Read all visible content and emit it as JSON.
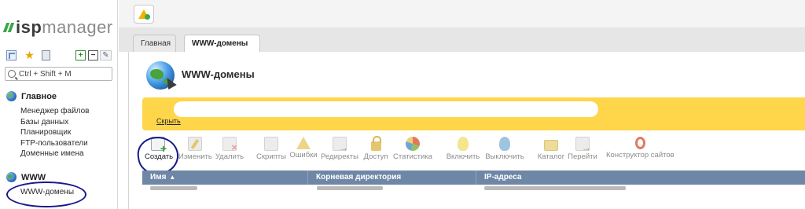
{
  "logo": {
    "isp": "isp",
    "manager": "manager"
  },
  "sidebar": {
    "search": {
      "placeholder": "Ctrl + Shift + M"
    },
    "toolbar_icons": [
      "tree-view-icon",
      "star-icon",
      "clipboard-icon",
      "expand-all-icon",
      "collapse-all-icon",
      "pin-icon"
    ],
    "sections": [
      {
        "title": "Главное",
        "items": [
          {
            "label": "Менеджер файлов"
          },
          {
            "label": "Базы данных"
          },
          {
            "label": "Планировщик"
          },
          {
            "label": "FTP-пользователи"
          },
          {
            "label": "Доменные имена"
          }
        ]
      },
      {
        "title": "WWW",
        "items": [
          {
            "label": "WWW-домены"
          }
        ]
      }
    ]
  },
  "tabs": [
    {
      "label": "Главная",
      "active": false
    },
    {
      "label": "WWW-домены",
      "active": true
    }
  ],
  "page": {
    "title": "WWW-домены",
    "notice": {
      "hide_label": "Скрыть",
      "background": "#ffd54a"
    }
  },
  "toolbar": [
    {
      "label": "Создать",
      "icon": "create-icon",
      "enabled": true
    },
    {
      "label": "Изменить",
      "icon": "edit-icon",
      "enabled": false
    },
    {
      "label": "Удалить",
      "icon": "delete-icon",
      "enabled": false
    },
    {
      "label": "Скрипты",
      "icon": "scripts-icon",
      "enabled": false
    },
    {
      "label": "Ошибки",
      "icon": "errors-icon",
      "enabled": false
    },
    {
      "label": "Редиректы",
      "icon": "redirects-icon",
      "enabled": false
    },
    {
      "label": "Доступ",
      "icon": "access-icon",
      "enabled": false
    },
    {
      "label": "Статистика",
      "icon": "statistics-icon",
      "enabled": false
    },
    {
      "label": "Включить",
      "icon": "enable-icon",
      "enabled": false
    },
    {
      "label": "Выключить",
      "icon": "disable-icon",
      "enabled": false
    },
    {
      "label": "Каталог",
      "icon": "folder-icon",
      "enabled": false
    },
    {
      "label": "Перейти",
      "icon": "go-icon",
      "enabled": false
    },
    {
      "label": "Конструктор сайтов",
      "icon": "site-builder-icon",
      "enabled": false
    }
  ],
  "table": {
    "columns": [
      {
        "label": "Имя",
        "sorted": "asc"
      },
      {
        "label": "Корневая директория"
      },
      {
        "label": "IP-адреса"
      }
    ],
    "header_color": "#6f87a7"
  },
  "colors": {
    "brand_green": "#3aa74a",
    "annotation_ink": "#15198a"
  }
}
